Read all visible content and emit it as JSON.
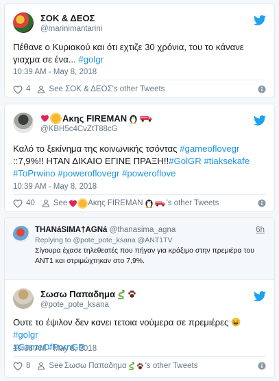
{
  "tweets": [
    {
      "name": "ΣΟΚ & ΔΕΟΣ",
      "handle": "@marinimantarini",
      "text_main": "Πέθανε ο Κυριακού και ότι εχτιζε 30 χρόνια, του το κάνανε γιαχμα σε ένα... ",
      "hashtag": "#golgr",
      "timestamp": "10:39 AM - May 8, 2018",
      "likes": "4",
      "see_prefix": "See",
      "see_name": "ΣΟΚ & ΔΕΟΣ",
      "see_suffix": "'s other Tweets"
    },
    {
      "name": "Ακης FIREMAN",
      "handle": "@KBH5c4CvZtT88cG",
      "text_main": "Καλό το ξεκίνημα της κοινωνικής τσόντας ",
      "hashtag1": "#gameoflovegr",
      "text_mid": " ::7,9%!! ΗΤΑΝ ΔΙΚΑΙΟ ΕΓΙΝΕ ΠΡΑΞΗ!!",
      "hashtags2": "#GolGR #tiaksekafe #ToPrwino #poweroflovegr #poweroflove",
      "timestamp": "10:39 AM - May 8, 2018",
      "likes": "40",
      "see_prefix": "See",
      "see_name": "Ακης FIREMAN",
      "see_suffix": "'s other Tweets"
    },
    {
      "reply_to": {
        "name": "THANáSIMA†AGNá",
        "handle": "@thanasima_agna",
        "time": "6h",
        "replying": "Replying to @pote_pote_ksana @ANT1TV",
        "text": "Σίγουρα έχασε τηλεθεατές που πήγαν για κράξιμο στην πρεμιέρα του ANT1 και στριμώχτηκαν στο 7,9%."
      },
      "name": "Σωσω Παπαδημα",
      "handle": "@pote_pote_ksana",
      "text_main": "Ουτε το έψιλον δεν κανει τετοια νούμερα σε πρεμιέρες ",
      "hashtag1": "#golgr",
      "hashtag2": "#GameOfPornGR",
      "timestamp": "10:38 AM - May 8, 2018",
      "likes": "8",
      "see_prefix": "See",
      "see_name": "Σωσω Παπαδημα",
      "see_suffix": "'s other Tweets"
    }
  ],
  "colors": {
    "link": "#1b95e0",
    "muted": "#657786",
    "twitter_blue": "#1da1f2"
  },
  "icons": [
    "twitter-bird-icon",
    "heart-icon",
    "person-icon",
    "info-icon"
  ]
}
